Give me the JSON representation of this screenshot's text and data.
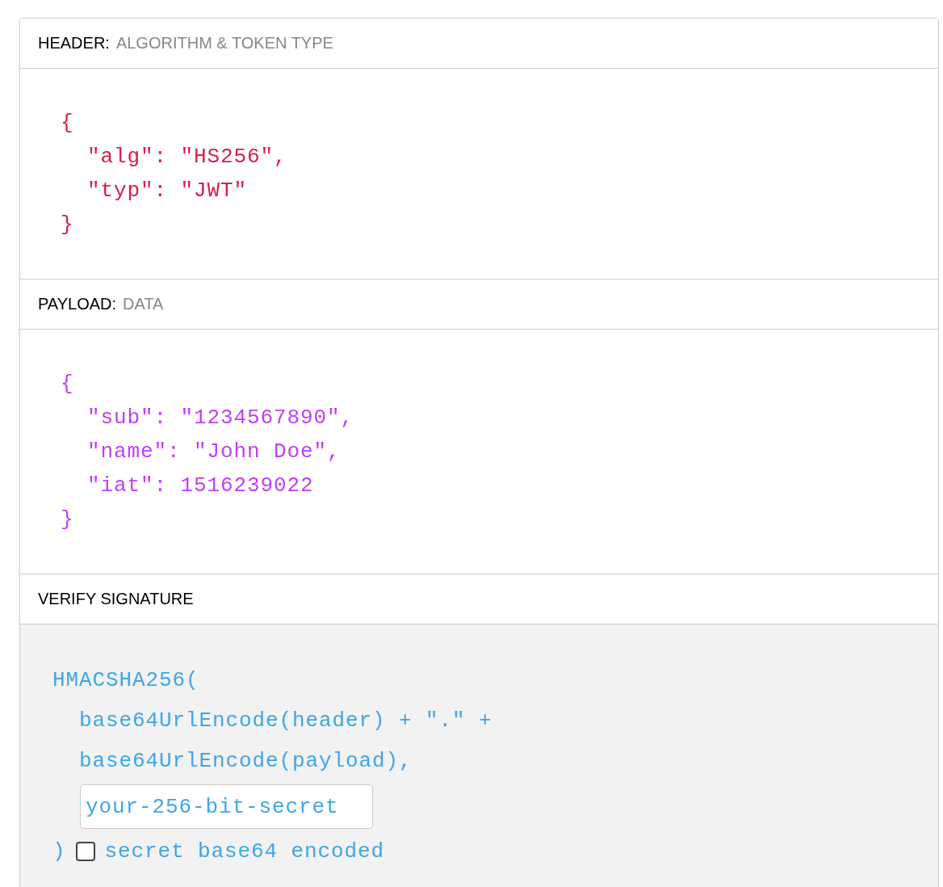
{
  "sections": [
    {
      "kind": "code",
      "title": "HEADER:",
      "subtitle": "ALGORITHM & TOKEN TYPE",
      "color": "#d6204b",
      "lines": [
        "{",
        "  \"alg\": \"HS256\",",
        "  \"typ\": \"JWT\"",
        "}"
      ]
    },
    {
      "kind": "code",
      "title": "PAYLOAD:",
      "subtitle": "DATA",
      "color": "#c13ef5",
      "lines": [
        "{",
        "  \"sub\": \"1234567890\",",
        "  \"name\": \"John Doe\",",
        "  \"iat\": 1516239022",
        "}"
      ]
    },
    {
      "kind": "signature",
      "title": "VERIFY SIGNATURE",
      "color": "#3ea6e6",
      "lines": [
        "HMACSHA256(",
        "  base64UrlEncode(header) + \".\" +",
        "  base64UrlEncode(payload),"
      ],
      "secret": {
        "value": "your-256-bit-secret"
      },
      "close": ")",
      "checkbox": {
        "label": "secret base64 encoded",
        "checked": false
      }
    }
  ]
}
